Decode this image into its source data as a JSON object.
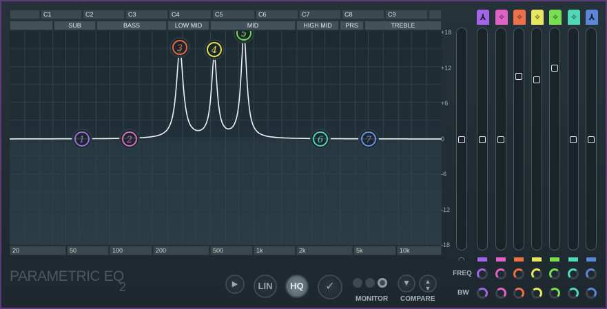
{
  "app": {
    "title": "PARAMETRIC EQ",
    "title_suffix": "2"
  },
  "notes": [
    "",
    "C1",
    "C2",
    "C3",
    "C4",
    "C5",
    "C6",
    "C7",
    "C8",
    "C9",
    ""
  ],
  "bands_ranges": [
    "",
    "SUB",
    "BASS",
    "LOW MID",
    "MID",
    "HIGH MID",
    "PRS",
    "TREBLE"
  ],
  "freq_labels": [
    "20",
    "50",
    "100",
    "200",
    "500",
    "1k",
    "2k",
    "5k",
    "10k"
  ],
  "db_labels": [
    "+18",
    "+12",
    "+6",
    "0",
    "-6",
    "-12",
    "-18"
  ],
  "band_points": [
    {
      "label": "1",
      "color": "#9a6fe0"
    },
    {
      "label": "2",
      "color": "#d96cc4"
    },
    {
      "label": "3",
      "color": "#e86a4a"
    },
    {
      "label": "4",
      "color": "#e8e05a"
    },
    {
      "label": "5",
      "color": "#6fe04e"
    },
    {
      "label": "6",
      "color": "#4ed4b0"
    },
    {
      "label": "7",
      "color": "#6e8fe8"
    }
  ],
  "sliders": [
    {
      "color": "#a264e8",
      "icon": "highpass-icon",
      "glyph": "⅄",
      "gain_db": 0
    },
    {
      "color": "#e061c8",
      "icon": "peak-icon",
      "glyph": "✧",
      "gain_db": 0
    },
    {
      "color": "#ee7048",
      "icon": "peak-icon",
      "glyph": "✧",
      "gain_db": 11
    },
    {
      "color": "#e8e85e",
      "icon": "peak-icon",
      "glyph": "✧",
      "gain_db": 10.5
    },
    {
      "color": "#76e04e",
      "icon": "peak-icon",
      "glyph": "✧",
      "gain_db": 12.5
    },
    {
      "color": "#52d7b4",
      "icon": "peak-icon",
      "glyph": "✧",
      "gain_db": 0
    },
    {
      "color": "#5d86d6",
      "icon": "lowpass-icon",
      "glyph": "⅄",
      "gain_db": 0
    }
  ],
  "labels": {
    "freq": "FREQ",
    "bw": "BW",
    "monitor": "MONITOR",
    "compare": "COMPARE"
  },
  "buttons": {
    "lin": "LIN",
    "hq": "HQ",
    "play": "▶",
    "check": "✓"
  }
}
